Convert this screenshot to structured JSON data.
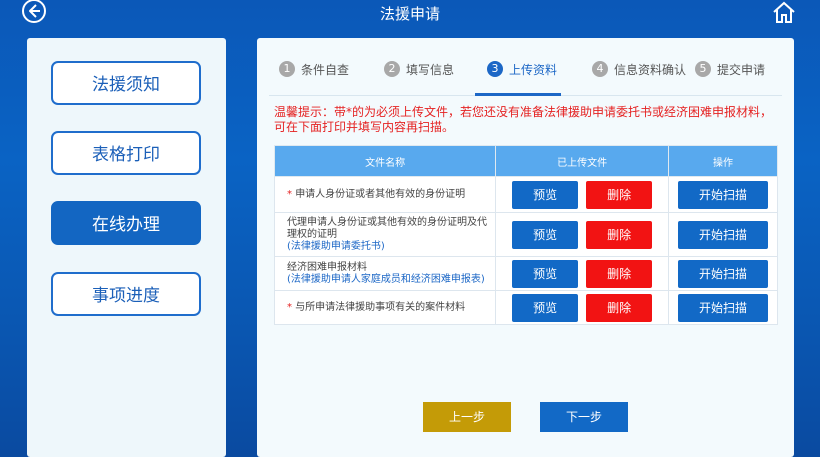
{
  "header": {
    "title": "法援申请",
    "back_icon": "back-arrow-circle-icon",
    "home_icon": "home-icon"
  },
  "sidebar": {
    "items": [
      {
        "label": "法援须知",
        "active": false
      },
      {
        "label": "表格打印",
        "active": false
      },
      {
        "label": "在线办理",
        "active": true
      },
      {
        "label": "事项进度",
        "active": false
      }
    ]
  },
  "steps": [
    {
      "num": "1",
      "label": "条件自查"
    },
    {
      "num": "2",
      "label": "填写信息"
    },
    {
      "num": "3",
      "label": "上传资料",
      "active": true
    },
    {
      "num": "4",
      "label": "信息资料确认"
    },
    {
      "num": "5",
      "label": "提交申请"
    }
  ],
  "tip": "温馨提示：带*的为必须上传文件，若您还没有准备法律援助申请委托书或经济困难申报材料，可在下面打印并填写内容再扫描。",
  "table": {
    "headers": {
      "name": "文件名称",
      "uploaded": "已上传文件",
      "action": "操作"
    },
    "rows": [
      {
        "req": "* ",
        "name": "申请人身份证或者其他有效的身份证明",
        "sub": "",
        "preview": "预览",
        "delete": "删除",
        "scan": "开始扫描"
      },
      {
        "req": "",
        "name": "代理申请人身份证或其他有效的身份证明及代理权的证明",
        "sub": "(法律援助申请委托书)",
        "preview": "预览",
        "delete": "删除",
        "scan": "开始扫描"
      },
      {
        "req": "",
        "name": "经济困难申报材料",
        "sub": "(法律援助申请人家庭成员和经济困难申报表)",
        "preview": "预览",
        "delete": "删除",
        "scan": "开始扫描"
      },
      {
        "req": "* ",
        "name": "与所申请法律援助事项有关的案件材料",
        "sub": "",
        "preview": "预览",
        "delete": "删除",
        "scan": "开始扫描"
      }
    ]
  },
  "nav": {
    "prev": "上一步",
    "next": "下一步"
  },
  "colors": {
    "accent": "#1269c6",
    "danger": "#f21313",
    "prev": "#c49b07",
    "tip": "#e52222",
    "header_row": "#58a9ee"
  }
}
